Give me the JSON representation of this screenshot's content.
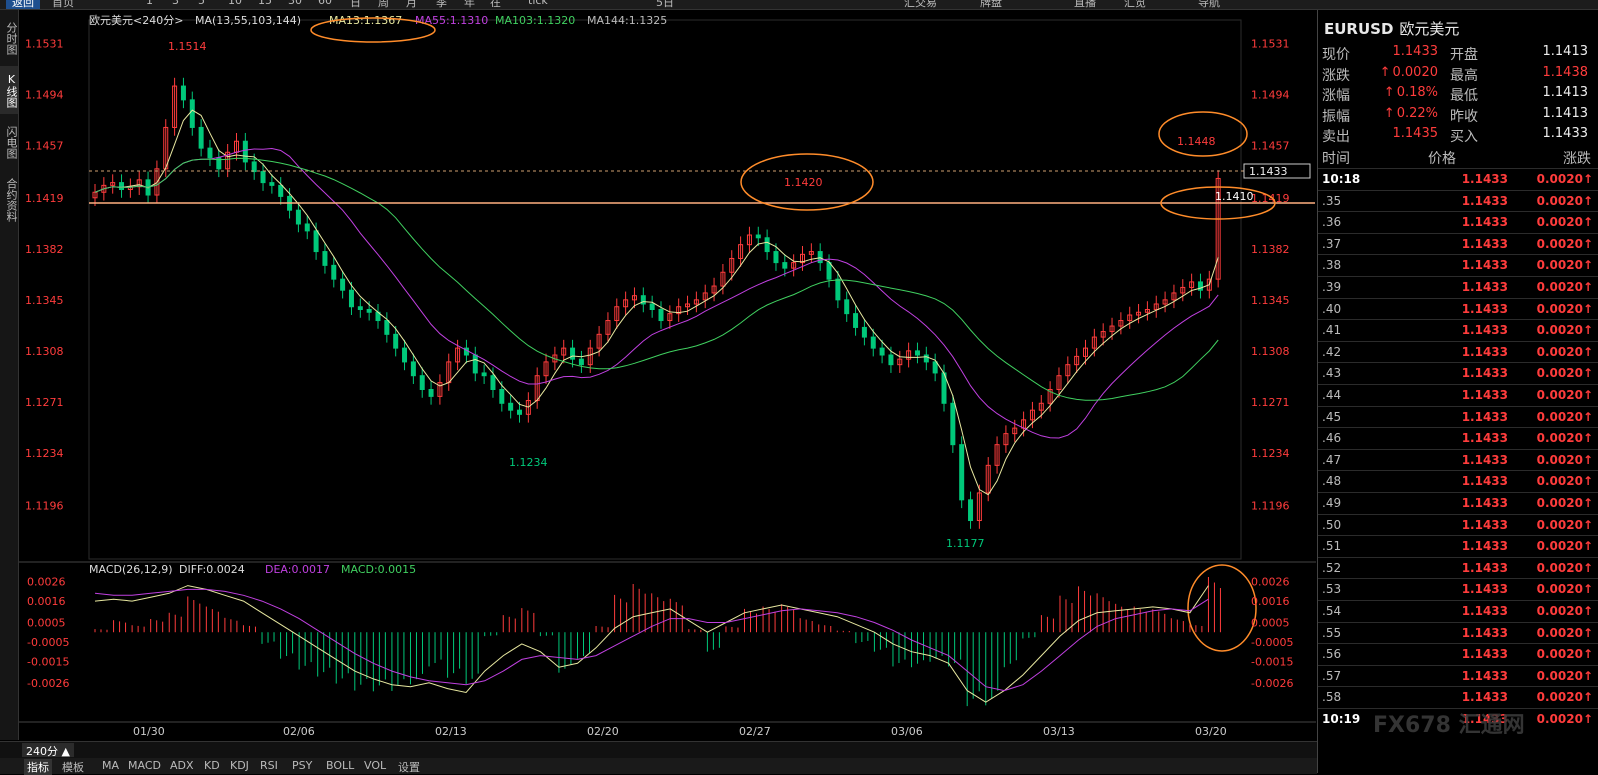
{
  "toolbar": {
    "items": [
      "返回",
      "首页",
      "1",
      "3",
      "5",
      "10",
      "15",
      "30",
      "60",
      "日",
      "周",
      "月",
      "季",
      "年",
      "在",
      "tick",
      "5日",
      "汇交易",
      "牌盘",
      "直播",
      "汇览",
      "导航"
    ]
  },
  "left_tabs": [
    "分时图",
    "K线图",
    "闪电图",
    "合约资料"
  ],
  "chart_header": {
    "name": "欧元美元<240分>",
    "ma_label": "MA(13,55,103,144)",
    "ma13": "MA13:1.1367",
    "ma55": "MA55:1.1310",
    "ma103": "MA103:1.1320",
    "ma144": "MA144:1.1325"
  },
  "colors": {
    "up": "#ff3c3c",
    "down": "#00c87a",
    "ma13": "#e8e8a0",
    "ma55": "#c040e0",
    "ma103": "#40d060",
    "ma144": "#c0a040",
    "circle": "#ff8c2a",
    "hline": "#ffb080"
  },
  "price_axis": [
    "1.1531",
    "1.1494",
    "1.1457",
    "1.1419",
    "1.1382",
    "1.1345",
    "1.1308",
    "1.1271",
    "1.1234",
    "1.1196"
  ],
  "current_price_box": "1.1433",
  "price_labels": {
    "high1": "1.1514",
    "low1": "1.1234",
    "mid_high": "1.1420",
    "low2": "1.1177",
    "recent_high": "1.1448",
    "level": "1.1410"
  },
  "macd_header": {
    "label": "MACD(26,12,9)",
    "diff": "DIFF:0.0024",
    "dea": "DEA:0.0017",
    "macd": "MACD:0.0015"
  },
  "macd_axis": [
    "0.0026",
    "0.0016",
    "0.0005",
    "-0.0005",
    "-0.0015",
    "-0.0026"
  ],
  "date_axis": [
    "01/30",
    "02/06",
    "02/13",
    "02/20",
    "02/27",
    "03/06",
    "03/13",
    "03/20"
  ],
  "chart_data": {
    "type": "candlestick",
    "y_range": [
      1.116,
      1.1545
    ],
    "price_series": [
      1.1423,
      1.1428,
      1.143,
      1.1425,
      1.1427,
      1.1432,
      1.1421,
      1.144,
      1.147,
      1.15,
      1.149,
      1.147,
      1.1455,
      1.1448,
      1.144,
      1.1452,
      1.146,
      1.1445,
      1.1438,
      1.143,
      1.1428,
      1.142,
      1.141,
      1.14,
      1.1395,
      1.138,
      1.137,
      1.136,
      1.1352,
      1.134,
      1.1338,
      1.1336,
      1.133,
      1.132,
      1.131,
      1.13,
      1.129,
      1.128,
      1.1275,
      1.1285,
      1.13,
      1.131,
      1.1305,
      1.1292,
      1.129,
      1.128,
      1.127,
      1.1265,
      1.1262,
      1.1272,
      1.129,
      1.13,
      1.1305,
      1.131,
      1.1302,
      1.1298,
      1.131,
      1.132,
      1.133,
      1.134,
      1.1345,
      1.1348,
      1.1342,
      1.1338,
      1.133,
      1.1335,
      1.134,
      1.1342,
      1.1345,
      1.135,
      1.1355,
      1.1365,
      1.1375,
      1.1385,
      1.1392,
      1.139,
      1.138,
      1.1372,
      1.1368,
      1.1372,
      1.1378,
      1.138,
      1.1372,
      1.136,
      1.1345,
      1.1335,
      1.1325,
      1.1318,
      1.131,
      1.1305,
      1.1298,
      1.1302,
      1.1308,
      1.1305,
      1.13,
      1.1292,
      1.127,
      1.124,
      1.12,
      1.1185,
      1.1205,
      1.1225,
      1.124,
      1.1248,
      1.1252,
      1.1258,
      1.1265,
      1.127,
      1.128,
      1.129,
      1.1298,
      1.1304,
      1.131,
      1.1318,
      1.1322,
      1.1326,
      1.133,
      1.1334,
      1.1336,
      1.1338,
      1.1342,
      1.1345,
      1.135,
      1.1354,
      1.1358,
      1.1352,
      1.136,
      1.1433
    ],
    "macd_diff": [
      0.0016,
      0.0017,
      0.0016,
      0.0018,
      0.002,
      0.0024,
      0.0022,
      0.0019,
      0.0016,
      0.001,
      0.0004,
      -0.0002,
      -0.0008,
      -0.0014,
      -0.002,
      -0.0024,
      -0.0027,
      -0.0028,
      -0.0026,
      -0.0029,
      -0.0031,
      -0.002,
      -0.0012,
      -0.0006,
      -0.001,
      -0.0018,
      -0.0016,
      -0.0008,
      0.0002,
      0.0008,
      0.001,
      0.0012,
      0.0006,
      0.0,
      0.0005,
      0.001,
      0.0012,
      0.0014,
      0.0012,
      0.001,
      0.0008,
      0.0004,
      0.0,
      -0.0006,
      -0.001,
      -0.0012,
      -0.0016,
      -0.003,
      -0.0036,
      -0.003,
      -0.0022,
      -0.0012,
      -0.0002,
      0.0006,
      0.001,
      0.0011,
      0.0012,
      0.0013,
      0.0012,
      0.001,
      0.0024
    ],
    "macd_dea": [
      0.002,
      0.0019,
      0.0019,
      0.002,
      0.0021,
      0.0022,
      0.0022,
      0.0021,
      0.0019,
      0.0016,
      0.0012,
      0.0007,
      0.0001,
      -0.0005,
      -0.0011,
      -0.0016,
      -0.002,
      -0.0023,
      -0.0025,
      -0.0026,
      -0.0027,
      -0.0025,
      -0.002,
      -0.0014,
      -0.0012,
      -0.0013,
      -0.0014,
      -0.0012,
      -0.0007,
      -0.0002,
      0.0003,
      0.0007,
      0.0007,
      0.0005,
      0.0005,
      0.0007,
      0.0009,
      0.0011,
      0.0012,
      0.0011,
      0.001,
      0.0008,
      0.0005,
      0.0001,
      -0.0004,
      -0.0008,
      -0.0012,
      -0.002,
      -0.0028,
      -0.003,
      -0.0027,
      -0.002,
      -0.0012,
      -0.0004,
      0.0003,
      0.0007,
      0.0009,
      0.0011,
      0.0012,
      0.0011,
      0.0017
    ]
  },
  "quote": {
    "symbol": "EURUSD",
    "name": "欧元美元",
    "rows": [
      {
        "l1": "现价",
        "v1": "1.1433",
        "l2": "开盘",
        "v2": "1.1413"
      },
      {
        "l1": "涨跌",
        "v1": "0.0020",
        "l2": "最高",
        "v2": "1.1438"
      },
      {
        "l1": "涨幅",
        "v1": "0.18%",
        "l2": "最低",
        "v2": "1.1413"
      },
      {
        "l1": "振幅",
        "v1": "0.22%",
        "l2": "昨收",
        "v2": "1.1413"
      },
      {
        "l1": "卖出",
        "v1": "1.1435",
        "l2": "买入",
        "v2": "1.1433"
      }
    ]
  },
  "ticks_header": {
    "time": "时间",
    "price": "价格",
    "change": "涨跌"
  },
  "ticks": [
    {
      "t": "10:18",
      "p": "1.1433",
      "c": "0.0020"
    },
    {
      "t": ".35",
      "p": "1.1433",
      "c": "0.0020"
    },
    {
      "t": ".36",
      "p": "1.1433",
      "c": "0.0020"
    },
    {
      "t": ".37",
      "p": "1.1433",
      "c": "0.0020"
    },
    {
      "t": ".38",
      "p": "1.1433",
      "c": "0.0020"
    },
    {
      "t": ".39",
      "p": "1.1433",
      "c": "0.0020"
    },
    {
      "t": ".40",
      "p": "1.1433",
      "c": "0.0020"
    },
    {
      "t": ".41",
      "p": "1.1433",
      "c": "0.0020"
    },
    {
      "t": ".42",
      "p": "1.1433",
      "c": "0.0020"
    },
    {
      "t": ".43",
      "p": "1.1433",
      "c": "0.0020"
    },
    {
      "t": ".44",
      "p": "1.1433",
      "c": "0.0020"
    },
    {
      "t": ".45",
      "p": "1.1433",
      "c": "0.0020"
    },
    {
      "t": ".46",
      "p": "1.1433",
      "c": "0.0020"
    },
    {
      "t": ".47",
      "p": "1.1433",
      "c": "0.0020"
    },
    {
      "t": ".48",
      "p": "1.1433",
      "c": "0.0020"
    },
    {
      "t": ".49",
      "p": "1.1433",
      "c": "0.0020"
    },
    {
      "t": ".50",
      "p": "1.1433",
      "c": "0.0020"
    },
    {
      "t": ".51",
      "p": "1.1433",
      "c": "0.0020"
    },
    {
      "t": ".52",
      "p": "1.1433",
      "c": "0.0020"
    },
    {
      "t": ".53",
      "p": "1.1433",
      "c": "0.0020"
    },
    {
      "t": ".54",
      "p": "1.1433",
      "c": "0.0020"
    },
    {
      "t": ".55",
      "p": "1.1433",
      "c": "0.0020"
    },
    {
      "t": ".56",
      "p": "1.1433",
      "c": "0.0020"
    },
    {
      "t": ".57",
      "p": "1.1433",
      "c": "0.0020"
    },
    {
      "t": ".58",
      "p": "1.1433",
      "c": "0.0020"
    },
    {
      "t": "10:19",
      "p": "1.1433",
      "c": "0.0020"
    }
  ],
  "period": "240分 ▲",
  "bottom_tabs": [
    "指标",
    "模板",
    "MA",
    "MACD",
    "ADX",
    "KD",
    "KDJ",
    "RSI",
    "PSY",
    "BOLL",
    "VOL",
    "设置"
  ],
  "watermark": "FX678 汇通网"
}
